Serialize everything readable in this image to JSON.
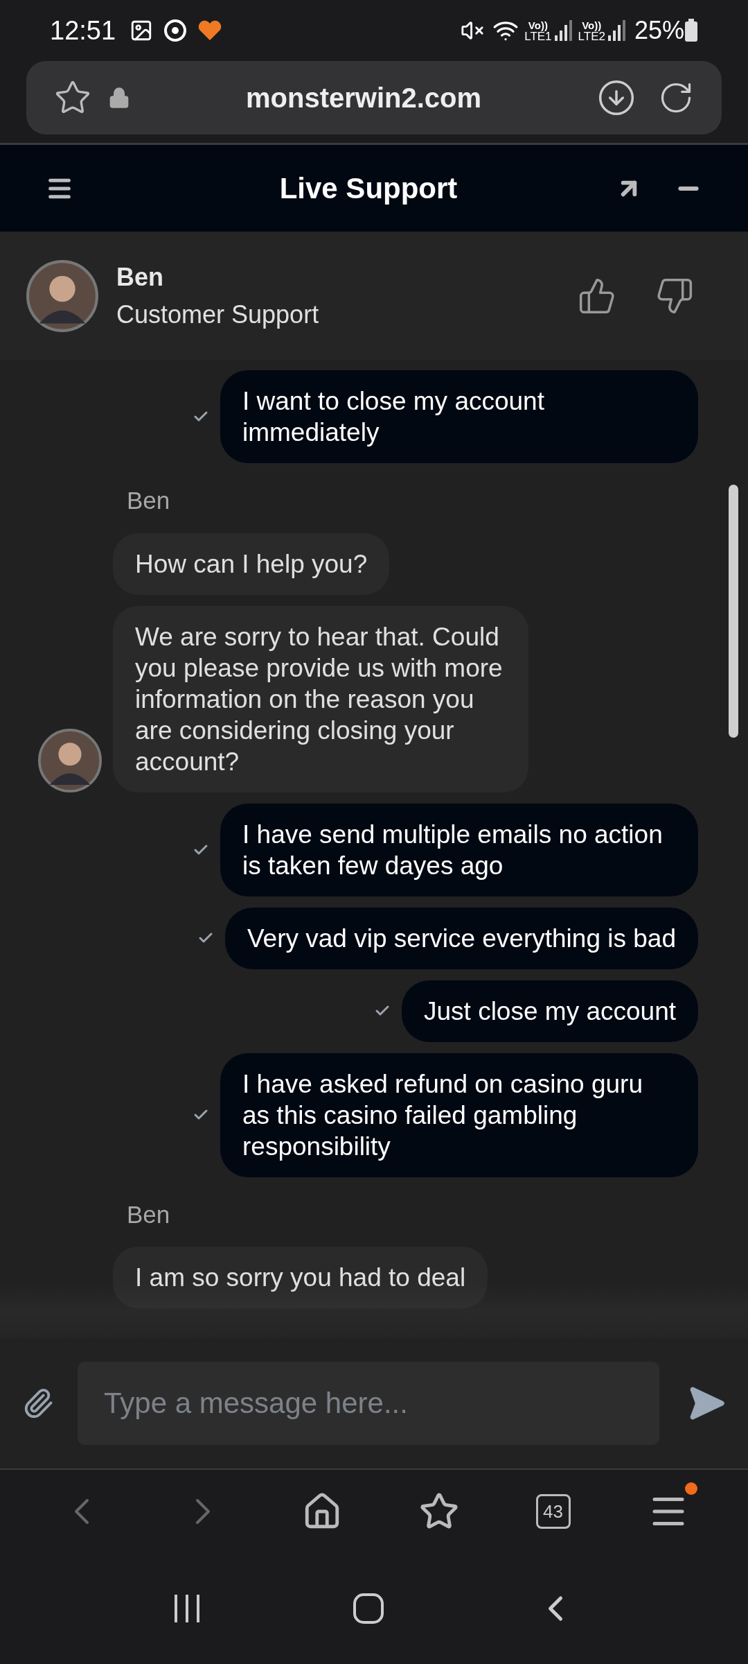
{
  "status_bar": {
    "time": "12:51",
    "sims": [
      {
        "top": "Vo))",
        "bottom": "LTE1"
      },
      {
        "top": "Vo))",
        "bottom": "LTE2"
      }
    ],
    "battery": "25%"
  },
  "address_bar": {
    "url": "monsterwin2.com"
  },
  "chat_header": {
    "title": "Live Support"
  },
  "agent": {
    "name": "Ben",
    "role": "Customer Support"
  },
  "messages": [
    {
      "kind": "sent",
      "text": "I want to close my account immediately",
      "read": true
    },
    {
      "kind": "sender",
      "text": "Ben"
    },
    {
      "kind": "received",
      "text": "How can I help you?",
      "avatar": false
    },
    {
      "kind": "received",
      "text": "We are sorry to hear that. Could you please provide us with more information on the reason you are considering closing your account?",
      "avatar": true
    },
    {
      "kind": "sent",
      "text": "I have send multiple emails no action is taken few dayes ago",
      "read": true
    },
    {
      "kind": "sent",
      "text": "Very vad vip service everything is bad",
      "read": true
    },
    {
      "kind": "sent",
      "text": "Just close my account",
      "read": true
    },
    {
      "kind": "sent",
      "text": "I have asked refund on casino guru as this casino failed gambling responsibility",
      "read": true
    },
    {
      "kind": "sender",
      "text": "Ben"
    },
    {
      "kind": "received",
      "text": "I am so sorry you had to deal",
      "avatar": false
    }
  ],
  "composer": {
    "placeholder": "Type a message here..."
  },
  "browser_nav": {
    "tab_count": "43",
    "menu_badge": true
  }
}
